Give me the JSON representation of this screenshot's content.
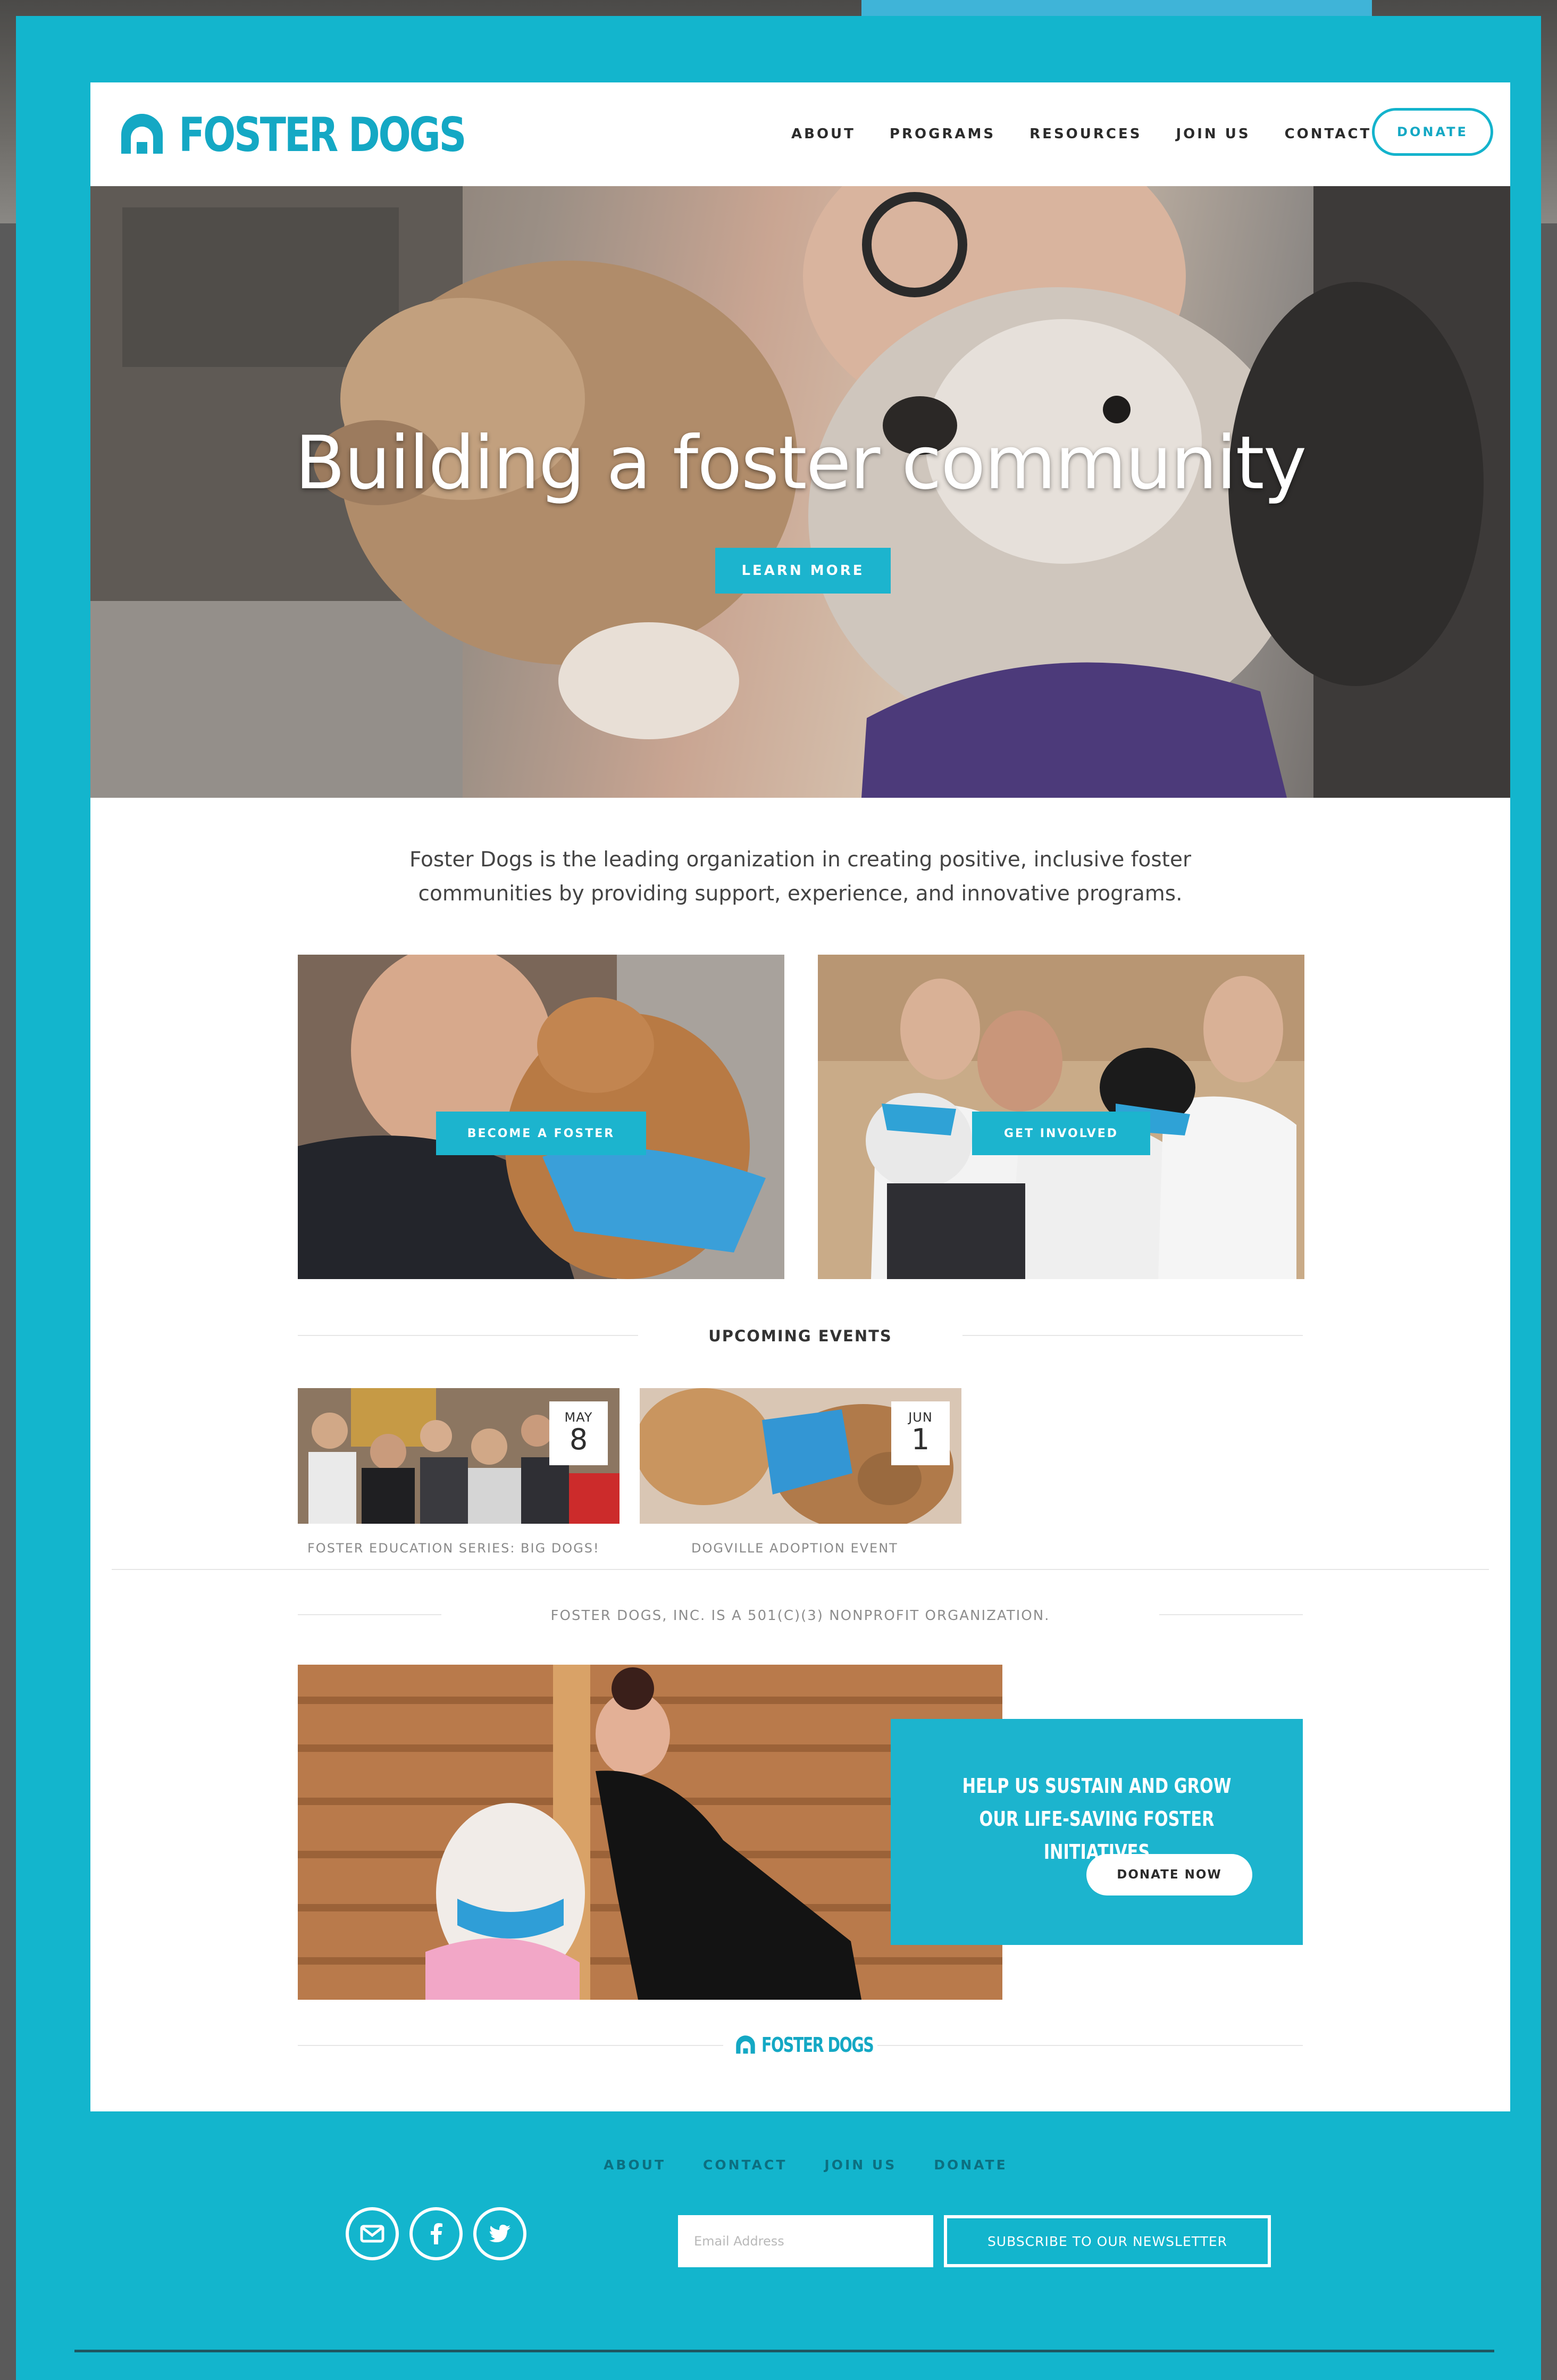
{
  "brand": {
    "name": "FOSTER DOGS",
    "accent_color": "#1cb4ce",
    "logo_icon": "house-arc-icon"
  },
  "nav": {
    "items": [
      "ABOUT",
      "PROGRAMS",
      "RESOURCES",
      "JOIN US",
      "CONTACT"
    ],
    "donate_label": "DONATE"
  },
  "hero": {
    "title": "Building a foster community",
    "button_label": "LEARN MORE"
  },
  "intro": {
    "text": "Foster Dogs is the leading organization in creating positive, inclusive foster communities by providing support, experience, and innovative programs."
  },
  "cards": [
    {
      "button_label": "BECOME A FOSTER"
    },
    {
      "button_label": "GET INVOLVED"
    }
  ],
  "events": {
    "title": "UPCOMING EVENTS",
    "items": [
      {
        "month": "MAY",
        "day": "8",
        "caption": "FOSTER EDUCATION SERIES: BIG DOGS!"
      },
      {
        "month": "JUN",
        "day": "1",
        "caption": "DOGVILLE ADOPTION EVENT"
      }
    ]
  },
  "nonprofit_note": "FOSTER DOGS, INC. IS A 501(C)(3) NONPROFIT ORGANIZATION.",
  "feature": {
    "heading": "HELP US SUSTAIN AND GROW OUR LIFE-SAVING FOSTER INITIATIVES",
    "button_label": "DONATE NOW"
  },
  "footer": {
    "nav": [
      "ABOUT",
      "CONTACT",
      "JOIN US",
      "DONATE"
    ],
    "social_icons": [
      "mail-icon",
      "facebook-icon",
      "twitter-icon"
    ],
    "email_placeholder": "Email Address",
    "subscribe_label": "SUBSCRIBE TO OUR NEWSLETTER"
  }
}
